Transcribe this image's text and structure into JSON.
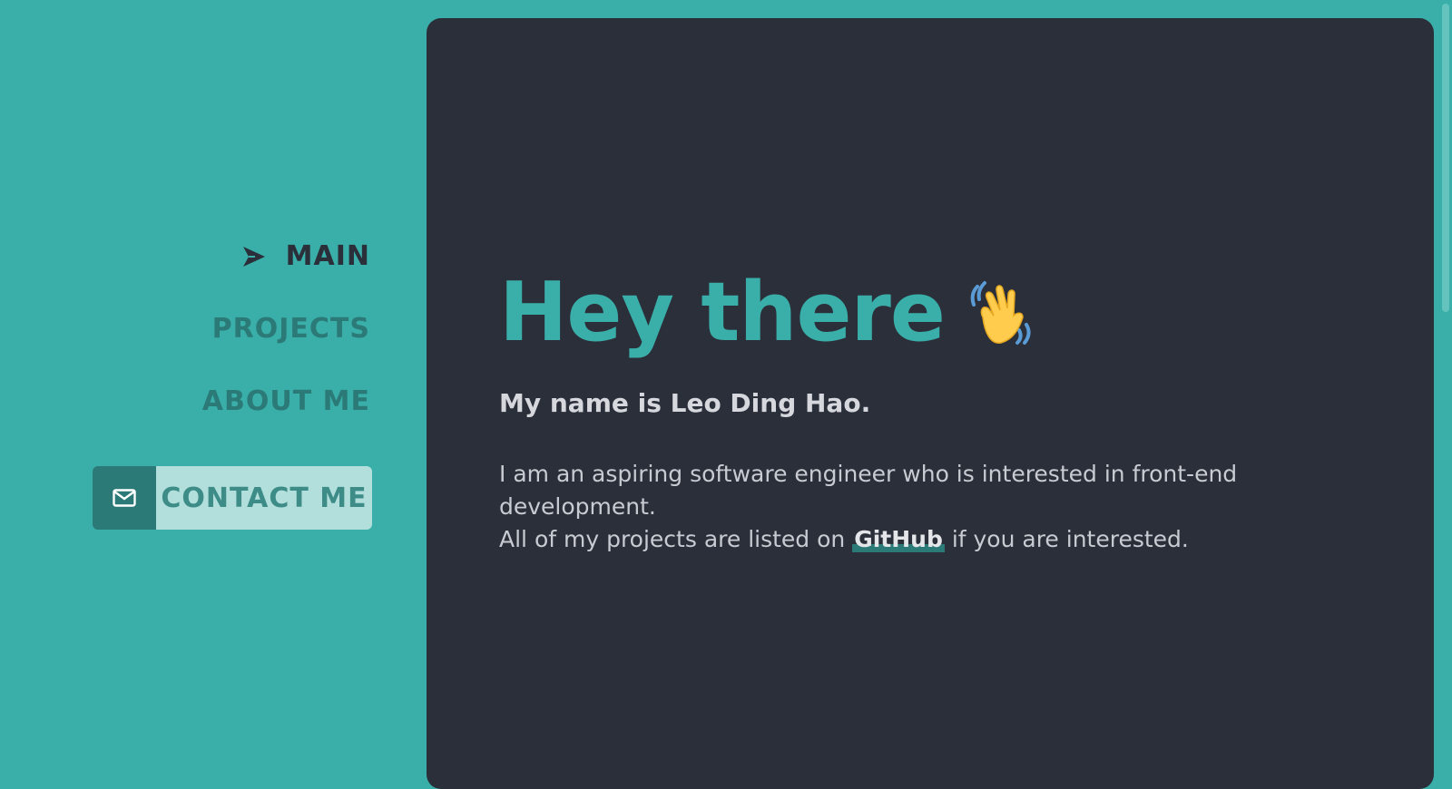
{
  "nav": {
    "items": [
      {
        "label": "MAIN",
        "active": true,
        "icon": "send-arrow-icon"
      },
      {
        "label": "PROJECTS",
        "active": false
      },
      {
        "label": "ABOUT ME",
        "active": false
      }
    ]
  },
  "contact": {
    "label": "CONTACT ME",
    "icon": "mail-icon"
  },
  "hero": {
    "title": "Hey there",
    "emoji": "waving-hand-icon",
    "subtitle": "My name is Leo Ding Hao.",
    "line1": "I am an aspiring software engineer who is interested in front-end development.",
    "line2_before": "All of my projects are listed on",
    "link": "GitHub",
    "line2_after": "if you are interested."
  },
  "colors": {
    "background": "#3aafa9",
    "card": "#2b2f3a",
    "accent": "#3aafa9",
    "nav_inactive": "#2b7a77",
    "contact_bg": "#b2dfdb"
  }
}
